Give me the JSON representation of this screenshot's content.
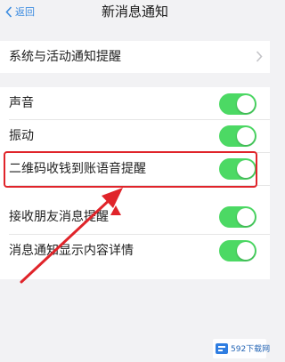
{
  "nav": {
    "back_label": "返回",
    "title": "新消息通知"
  },
  "rows": [
    {
      "label": "系统与活动通知提醒",
      "control": "chevron"
    },
    {
      "label": "声音",
      "control": "toggle",
      "on": true
    },
    {
      "label": "振动",
      "control": "toggle",
      "on": true
    },
    {
      "label": "二维码收钱到账语音提醒",
      "control": "toggle",
      "on": true,
      "highlighted": true
    },
    {
      "label": "接收朋友消息提醒",
      "control": "toggle",
      "on": true
    },
    {
      "label": "消息通知显示内容详情",
      "control": "toggle",
      "on": true
    }
  ],
  "colors": {
    "toggle_on": "#4cd964",
    "accent": "#3a8be0",
    "highlight": "#e0242a"
  },
  "watermark": {
    "text": "592下载网"
  },
  "icons": [
    "chevron-left-icon",
    "chevron-right-icon",
    "logo-icon"
  ]
}
